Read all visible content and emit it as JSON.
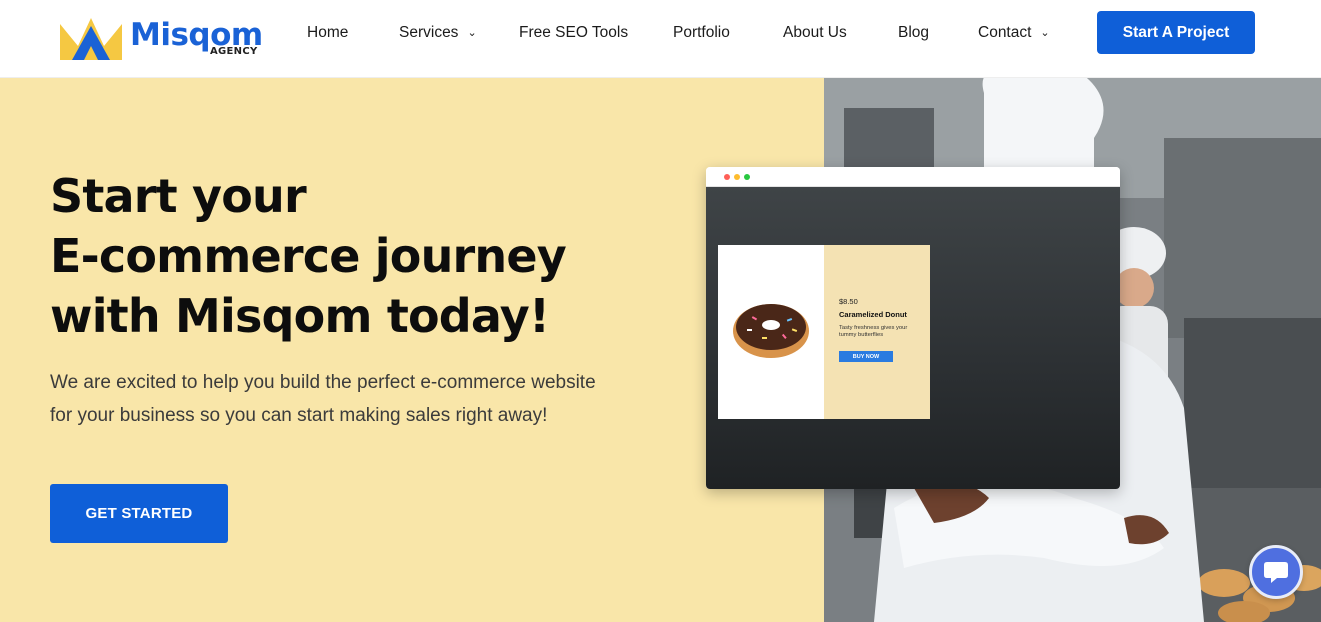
{
  "brand": {
    "name": "Misqom",
    "sub": "AGENCY",
    "primary_color": "#1a62d6",
    "accent_color": "#f5c842"
  },
  "nav": {
    "items": [
      {
        "label": "Home"
      },
      {
        "label": "Services",
        "dropdown": true
      },
      {
        "label": "Free SEO Tools"
      },
      {
        "label": "Portfolio"
      },
      {
        "label": "About Us"
      },
      {
        "label": "Blog"
      },
      {
        "label": "Contact",
        "dropdown": true
      }
    ],
    "cta": "Start A Project"
  },
  "hero": {
    "title_lines": [
      "Start your",
      "E-commerce journey",
      "with Misqom today!"
    ],
    "description": "We are excited to help you build the perfect e-commerce website for your business so you can start making sales right away!",
    "button": "GET STARTED",
    "background": "#f9e6a9"
  },
  "mockup": {
    "price": "$8.50",
    "product_name": "Caramelized Donut",
    "product_desc": "Tasty freshness gives your tummy butterflies",
    "buy_button": "BUY NOW"
  },
  "chat": {
    "icon": "chat-bubble-icon",
    "color": "#4f6fe0"
  }
}
